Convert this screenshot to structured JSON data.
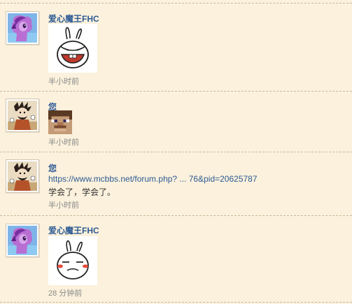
{
  "comments": [
    {
      "author": "爱心魔王FHC",
      "time": "半小时前",
      "avatar_icon": "purple-pony-avatar",
      "sticker_icon": "rabbit-laughing-sticker"
    },
    {
      "author": "您",
      "time": "半小时前",
      "avatar_icon": "wilson-character-avatar",
      "sticker_icon": "minecraft-face-sticker"
    },
    {
      "author": "您",
      "time": "半小时前",
      "avatar_icon": "wilson-character-avatar",
      "link": "https://www.mcbbs.net/forum.php? ... 76&pid=20625787",
      "text": "学会了，学会了。"
    },
    {
      "author": "爱心魔王FHC",
      "time": "28 分钟前",
      "avatar_icon": "purple-pony-avatar",
      "sticker_icon": "rabbit-blushing-sticker"
    }
  ],
  "colors": {
    "background": "#fbf1dc",
    "author": "#2d5b95",
    "time": "#8a8a8a",
    "divider": "#c9b89a"
  }
}
